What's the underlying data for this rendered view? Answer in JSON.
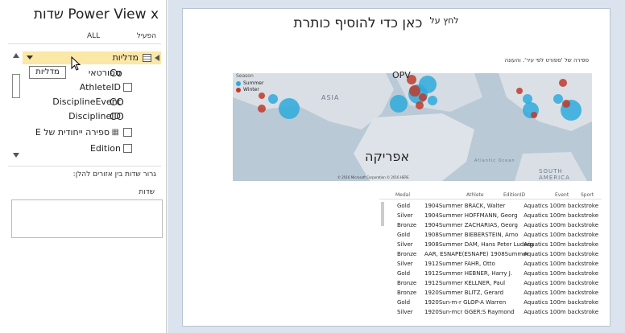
{
  "pane": {
    "title": "Power View x שדות",
    "tab_active": "הפעיל",
    "tab_all": "ALL",
    "table_name": "מדליות",
    "tooltip": "מדליות",
    "fields": [
      {
        "label": "ספורטאי",
        "type_icon": "Co"
      },
      {
        "label": "AthleteID",
        "type_icon": ""
      },
      {
        "label": "DisciplineEvent",
        "type_icon": "CO"
      },
      {
        "label": "DisciplineID",
        "type_icon": "CO"
      },
      {
        "label": "ספירה ייחודית של E",
        "type_icon": ""
      },
      {
        "label": "Edition",
        "type_icon": ""
      }
    ],
    "drag_hint": "גרור שדות בין אזורים להלן:",
    "fields_label": "שדות"
  },
  "canvas": {
    "title_small": "לחץ על",
    "title_big": "כאן כדי להוסיף כותרת",
    "map_caption": "ספירה של 'ספורט לפי עיר'. והעונה",
    "legend_title": "Season",
    "legend": [
      {
        "label": "Summer",
        "color": "#2eaadc"
      },
      {
        "label": "Winter",
        "color": "#c0392b"
      }
    ],
    "map_label_africa": "אפריקה",
    "map_label_asia": "ASIA",
    "map_label_south_america": "SOUTH AMERICA",
    "map_label_opv": "OPV",
    "map_label_atlantic": "Atlantic Ocean",
    "map_copyright": "© 2016 Microsoft Corporation  © 2016 HERE"
  },
  "table": {
    "headers": {
      "sport": "Sport",
      "event": "Event",
      "edition": "EditionID",
      "athlete": "Athlete",
      "medal": "Medal"
    },
    "rows": [
      {
        "sport": "Aquatics 100m backstroke",
        "athlete": "1904Summer BRACK, Walter",
        "medal": "Gold"
      },
      {
        "sport": "Aquatics 100m backstroke",
        "athlete": "1904Summer HOFFMANN, Georg",
        "medal": "Silver"
      },
      {
        "sport": "Aquatics 100m backstroke",
        "athlete": "1904Summer ZACHARIAS, Georg",
        "medal": "Bronze"
      },
      {
        "sport": "Aquatics 100m backstroke",
        "athlete": "1908Summer BIEBERSTEIN, Arno",
        "medal": "Gold"
      },
      {
        "sport": "Aquatics 100m backstroke",
        "athlete": "1908Summer DAM, Hans Peter Ludwig",
        "medal": "Silver"
      },
      {
        "sport": "Aquatics 100m backstroke",
        "athlete": "AAR, ESNAPE(ESNAPE) 1908Summer",
        "medal": "Bronze"
      },
      {
        "sport": "Aquatics 100m backstroke",
        "athlete": "1912Summer FAHR, Otto",
        "medal": "Silver"
      },
      {
        "sport": "Aquatics 100m backstroke",
        "athlete": "1912Summer HEBNER, Harry J.",
        "medal": "Gold"
      },
      {
        "sport": "Aquatics 100m backstroke",
        "athlete": "1912Summer KELLNER, Paul",
        "medal": "Bronze"
      },
      {
        "sport": "Aquatics 100m backstroke",
        "athlete": "1920Summer BLITZ, Gerard",
        "medal": "Bronze"
      },
      {
        "sport": "Aquatics 100m backstroke",
        "athlete": "1920Sun-m-r GLOP-A Warren",
        "medal": "Gold"
      },
      {
        "sport": "Aquatics 100m backstroke",
        "athlete": "1920Sun-mcr GGER:S Raymond",
        "medal": "Silver"
      }
    ]
  }
}
